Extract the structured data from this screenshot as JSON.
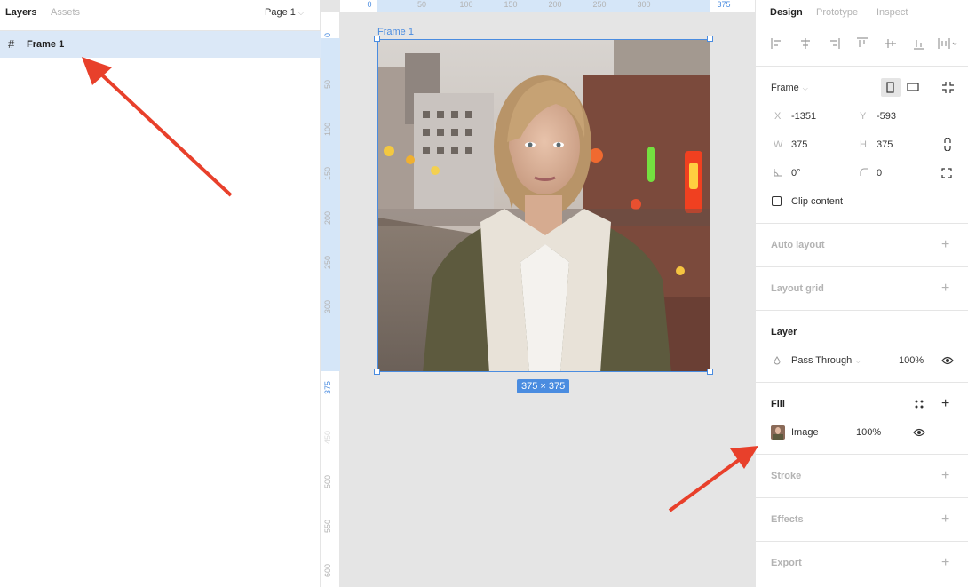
{
  "left_panel": {
    "tabs": [
      "Layers",
      "Assets"
    ],
    "page_select": "Page 1",
    "layers": [
      {
        "name": "Frame 1",
        "icon": "frame-hash-icon"
      }
    ]
  },
  "rulers": {
    "top": [
      "0",
      "50",
      "100",
      "150",
      "200",
      "250",
      "300",
      "375"
    ],
    "left": [
      "0",
      "50",
      "100",
      "150",
      "200",
      "250",
      "300",
      "375",
      "450",
      "500",
      "550",
      "600"
    ]
  },
  "canvas": {
    "frame_label": "Frame 1",
    "size_badge": "375 × 375",
    "selection_color": "#4a8ce0",
    "image": "photo-of-woman-in-olive-jacket-and-knit-scarf"
  },
  "right_panel": {
    "tabs": [
      "Design",
      "Prototype",
      "Inspect"
    ],
    "frame": {
      "type_label": "Frame",
      "x_label": "X",
      "x": "-1351",
      "y_label": "Y",
      "y": "-593",
      "w_label": "W",
      "w": "375",
      "h_label": "H",
      "h": "375",
      "rotation": "0°",
      "radius": "0",
      "clip_content": "Clip content"
    },
    "sections": {
      "auto_layout": "Auto layout",
      "layout_grid": "Layout grid",
      "layer": "Layer",
      "fill": "Fill",
      "stroke": "Stroke",
      "effects": "Effects",
      "export": "Export"
    },
    "layer": {
      "blend_mode": "Pass Through",
      "opacity": "100%"
    },
    "fill": {
      "type": "Image",
      "opacity": "100%"
    }
  },
  "annotations": {
    "arrow_color": "#e8402b"
  }
}
